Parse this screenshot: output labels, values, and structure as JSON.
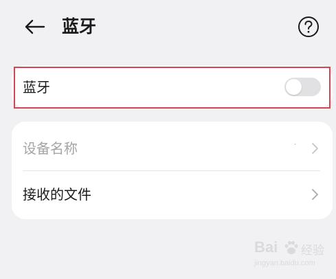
{
  "header": {
    "title": "蓝牙",
    "back_icon": "back-arrow-icon",
    "help_icon": "help-circle-icon"
  },
  "bluetooth_card": {
    "label": "蓝牙",
    "toggle_on": false
  },
  "settings_list": {
    "items": [
      {
        "label": "设备名称",
        "value": "˙",
        "enabled": false
      },
      {
        "label": "接收的文件",
        "enabled": true
      }
    ]
  },
  "highlight_color": "#d24552",
  "watermark": {
    "brand": "Bai",
    "brand2": "经验",
    "domain": "jingyan.baidu.com"
  }
}
